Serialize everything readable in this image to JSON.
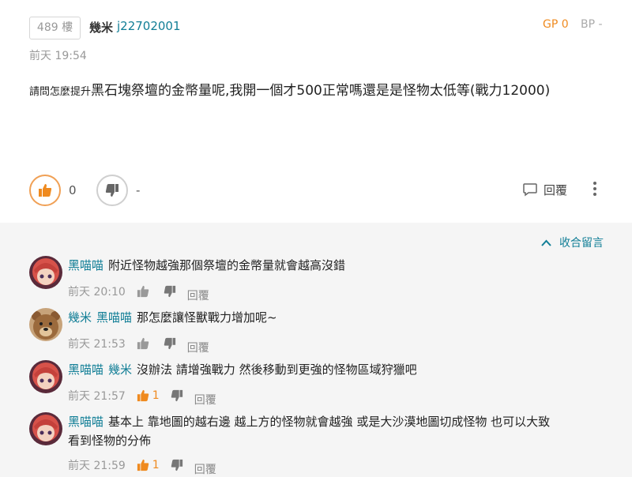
{
  "post": {
    "floor": "489 樓",
    "author_name": "幾米",
    "author_id": "j22702001",
    "gp": "GP 0",
    "bp": "BP -",
    "time": "前天 19:54",
    "content_small": "請問怎麼提升",
    "content_main": "黑石塊祭壇的金幣量呢,我開一個才500正常嗎還是是怪物太低等(戰力12000)",
    "like_count": "0",
    "dislike_count": "-",
    "reply_label": "回覆"
  },
  "comments_section": {
    "collapse_label": "收合留言",
    "items": [
      {
        "users": [
          "黑喵喵"
        ],
        "text": "附近怪物越強那個祭壇的金幣量就會越高沒錯",
        "time": "前天 20:10",
        "gp": "",
        "reply": "回覆"
      },
      {
        "users": [
          "幾米",
          "黑喵喵"
        ],
        "text": "那怎麼讓怪獸戰力增加呢~",
        "time": "前天 21:53",
        "gp": "",
        "reply": "回覆"
      },
      {
        "users": [
          "黑喵喵",
          "幾米"
        ],
        "text": "沒辦法 請增強戰力 然後移動到更強的怪物區域狩獵吧",
        "time": "前天 21:57",
        "gp": "1",
        "reply": "回覆"
      },
      {
        "users": [
          "黑喵喵"
        ],
        "text": "基本上 靠地圖的越右邊 越上方的怪物就會越強 或是大沙漠地圖切成怪物 也可以大致",
        "text2": "看到怪物的分佈",
        "time": "前天 21:59",
        "gp": "1",
        "reply": "回覆"
      }
    ]
  },
  "colors": {
    "accent": "#117e96",
    "gp": "#ef8a1f",
    "comments_bg": "#f5f5f5"
  }
}
